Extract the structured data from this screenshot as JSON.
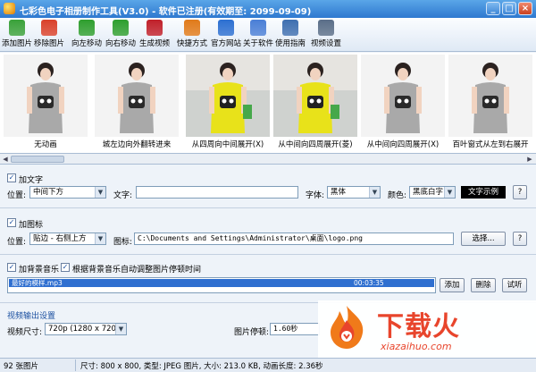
{
  "title": "七彩色电子相册制作工具(V3.0) - 软件已注册(有效期至: 2099-09-09)",
  "window_buttons": {
    "minimize": "_",
    "maximize": "□",
    "close": "×"
  },
  "toolbar": [
    {
      "label": "添加图片",
      "icon": "add-image-icon",
      "color": "#3aa13a"
    },
    {
      "label": "移除图片",
      "icon": "remove-image-icon",
      "color": "#d9412b"
    },
    {
      "label": "向左移动",
      "icon": "arrow-left-icon",
      "color": "#2f9e2f"
    },
    {
      "label": "向右移动",
      "icon": "arrow-right-icon",
      "color": "#2f9e2f"
    },
    {
      "label": "生成视频",
      "icon": "film-icon",
      "color": "#c0202a"
    },
    {
      "label": "快捷方式",
      "icon": "shortcut-icon",
      "color": "#e07a1a"
    },
    {
      "label": "官方网站",
      "icon": "globe-icon",
      "color": "#2c6fd1"
    },
    {
      "label": "关于软件",
      "icon": "info-icon",
      "color": "#4a7fd6"
    },
    {
      "label": "使用指南",
      "icon": "guide-icon",
      "color": "#3f6fb0"
    },
    {
      "label": "视频设置",
      "icon": "gear-icon",
      "color": "#5a6e88"
    }
  ],
  "thumbnails": [
    {
      "caption": "无动画",
      "scene": "grey"
    },
    {
      "caption": "城左边向外翻转进来",
      "scene": "grey"
    },
    {
      "caption": "从四周向中间展开(X)",
      "scene": "yellow"
    },
    {
      "caption": "从中间向四周展开(菱)",
      "scene": "yellow"
    },
    {
      "caption": "从中间向四周展开(X)",
      "scene": "grey"
    },
    {
      "caption": "百叶窗式从左到右展开",
      "scene": "grey"
    }
  ],
  "text_section": {
    "enabled_label": "加文字",
    "position_label": "位置:",
    "position_value": "中间下方",
    "text_label": "文字:",
    "text_value": "",
    "font_label": "字体:",
    "font_value": "黑体",
    "color_label": "颜色:",
    "color_value": "黑底白字",
    "sample_label": "文字示例",
    "help_label": "?"
  },
  "logo_section": {
    "enabled_label": "加图标",
    "position_label": "位置:",
    "position_value": "贴边  - 右侧上方",
    "icon_label": "图标:",
    "icon_path": "C:\\Documents and Settings\\Administrator\\桌面\\logo.png",
    "choose_label": "选择...",
    "help_label": "?"
  },
  "music_section": {
    "enabled_label": "加背景音乐",
    "auto_adjust_label": "根据背景音乐自动调整图片停顿时间",
    "track_name": "最好的模样.mp3",
    "track_duration": "00:03:35",
    "add_label": "添加",
    "delete_label": "删除",
    "listen_label": "试听"
  },
  "video_section": {
    "header": "视频输出设置",
    "size_label": "视频尺寸:",
    "size_value": "720p (1280 x  720)",
    "pause_label": "图片停顿:",
    "pause_value": "1.60秒"
  },
  "status": {
    "count": "92 张图片",
    "info": "尺寸: 800 x 800, 类型: JPEG 图片, 大小: 213.0 KB, 动画长度: 2.36秒"
  },
  "watermark": {
    "text": "下载火",
    "url": "xiazaihuo.com"
  }
}
